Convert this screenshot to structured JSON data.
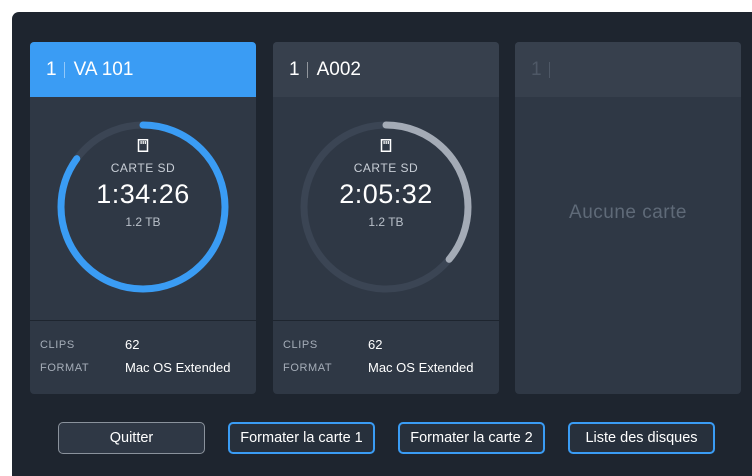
{
  "cards": [
    {
      "slot": "1",
      "name": "VA 101",
      "type": "CARTE SD",
      "time": "1:34:26",
      "size": "1.2 TB",
      "progress": 0.85,
      "ring_color": "#3a9cf4",
      "clips_label": "CLIPS",
      "clips_value": "62",
      "format_label": "FORMAT",
      "format_value": "Mac OS Extended"
    },
    {
      "slot": "1",
      "name": "A002",
      "type": "CARTE SD",
      "time": "2:05:32",
      "size": "1.2 TB",
      "progress": 0.36,
      "ring_color": "#a4abb6",
      "clips_label": "CLIPS",
      "clips_value": "62",
      "format_label": "FORMAT",
      "format_value": "Mac OS Extended"
    },
    {
      "slot": "1",
      "name": "",
      "empty_text": "Aucune carte"
    }
  ],
  "buttons": {
    "quit": "Quitter",
    "format1": "Formater la carte 1",
    "format2": "Formater la carte 2",
    "disk_list": "Liste des disques"
  },
  "colors": {
    "accent": "#3a9cf4",
    "background": "#1e252f",
    "card": "#2f3845"
  }
}
